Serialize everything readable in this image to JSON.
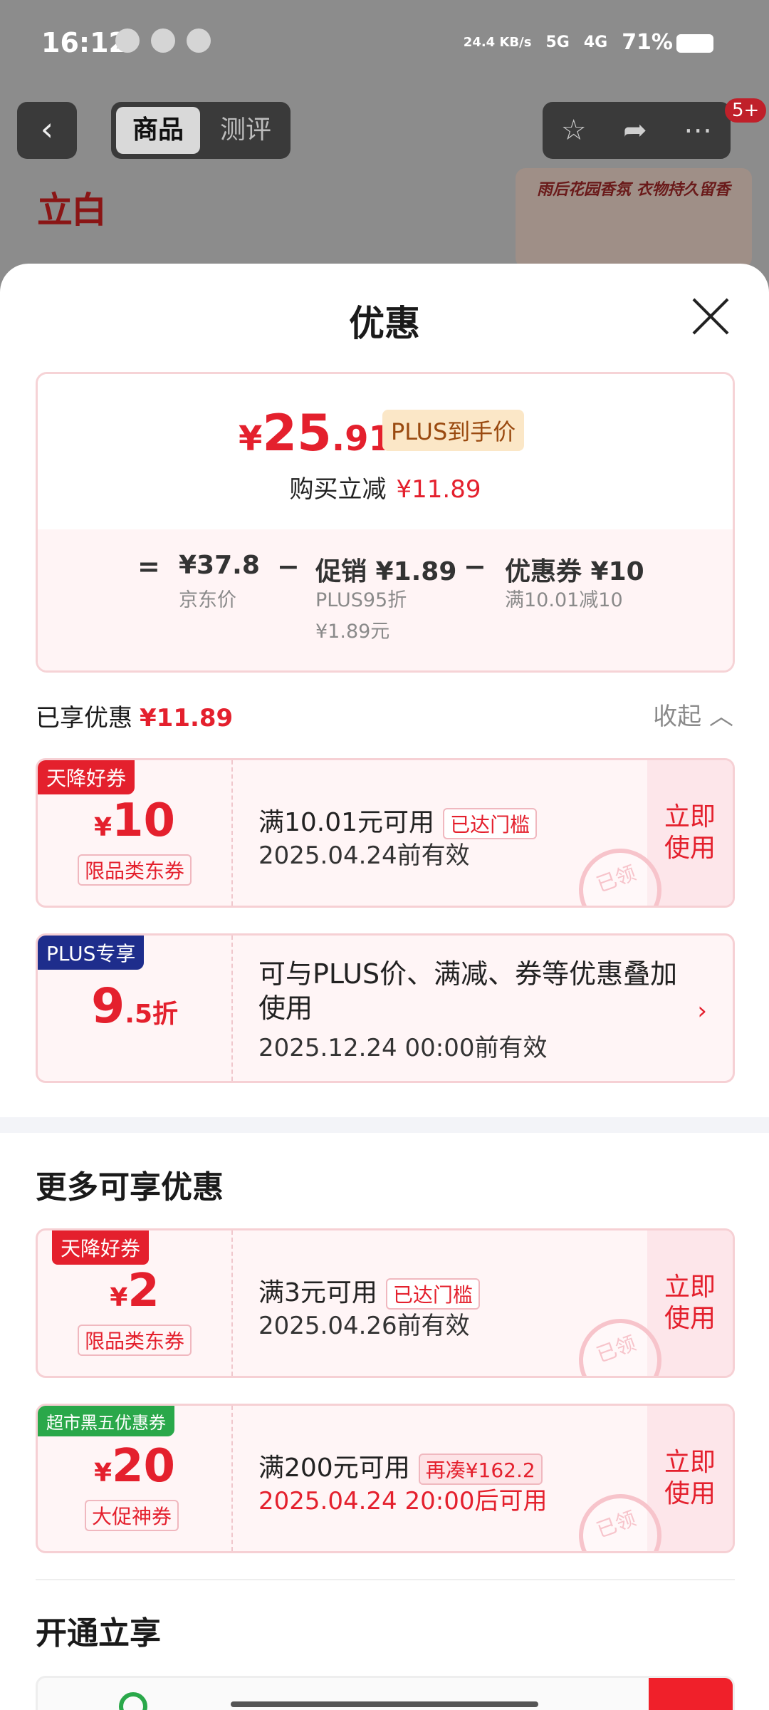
{
  "status": {
    "time": "16:12",
    "net_speed": "24.4 KB/s",
    "network1": "5G",
    "network2": "4G",
    "battery": "71%"
  },
  "nav": {
    "tab_product": "商品",
    "tab_review": "测评",
    "badge": "5+",
    "brand": "立白",
    "banner_text": "雨后花园香氛 衣物持久留香"
  },
  "sheet": {
    "title": "优惠",
    "price": {
      "yen": "¥",
      "int": "25",
      "dec": ".91",
      "tag": "PLUS到手价",
      "reduce_label": "购买立减",
      "reduce_amount": "¥11.89"
    },
    "calc": {
      "eq": "=",
      "base_value": "¥37.8",
      "base_label": "京东价",
      "minus": "−",
      "promo_value": "促销 ¥1.89",
      "promo_line1": "PLUS95折",
      "promo_line2": "¥1.89元",
      "coupon_value": "优惠券 ¥10",
      "coupon_label": "满10.01减10"
    },
    "enjoyed_label": "已享优惠",
    "enjoyed_amount": "¥11.89",
    "collapse_label": "收起",
    "coupons_enjoyed": [
      {
        "tag": "天降好券",
        "yen": "¥",
        "amount": "10",
        "type": "限品类东券",
        "condition": "满10.01元可用",
        "badge": "已达门槛",
        "date": "2025.04.24前有效",
        "action": "立即使用",
        "stamp": "已领"
      }
    ],
    "plus_card": {
      "tag": "PLUS专享",
      "rate": "9",
      "rate_dec": ".5折",
      "desc": "可与PLUS价、满减、券等优惠叠加使用",
      "date": "2025.12.24 00:00前有效",
      "arrow": "›"
    },
    "more_title": "更多可享优惠",
    "coupons_more": [
      {
        "tag": "天降好券",
        "yen": "¥",
        "amount": "2",
        "type": "限品类东券",
        "condition": "满3元可用",
        "badge": "已达门槛",
        "date": "2025.04.26前有效",
        "action": "立即使用",
        "stamp": "已领"
      },
      {
        "tag": "超市黑五优惠券",
        "yen": "¥",
        "amount": "20",
        "type": "大促神券",
        "condition": "满200元可用",
        "badge": "再凑¥162.2",
        "date": "2025.04.24 20:00后可用",
        "action": "立即使用",
        "stamp": "已领"
      }
    ],
    "open_title": "开通立享"
  },
  "colors": {
    "accent_red": "#e4202d",
    "plus_gold": "#fbe7c7",
    "plus_blue": "#1e2d8c",
    "green": "#2aa84a"
  }
}
